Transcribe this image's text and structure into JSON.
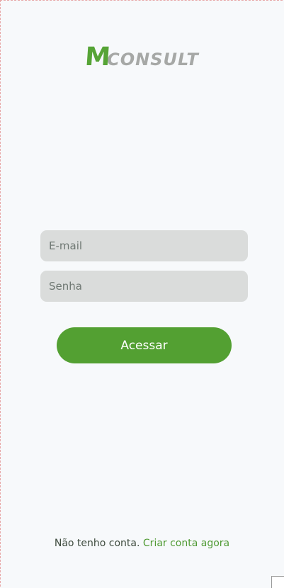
{
  "logo": {
    "letter": "M",
    "text": "CONSULT",
    "colors": {
      "letter": "#56a436",
      "text": "#a6a8a6"
    }
  },
  "form": {
    "email_placeholder": "E-mail",
    "password_placeholder": "Senha",
    "submit_label": "Acessar"
  },
  "footer": {
    "text": "Não tenho conta. ",
    "link": "Criar conta agora"
  },
  "colors": {
    "accent": "#53a032",
    "field_bg": "#dadcdb",
    "page_bg": "#f7f9fb"
  }
}
